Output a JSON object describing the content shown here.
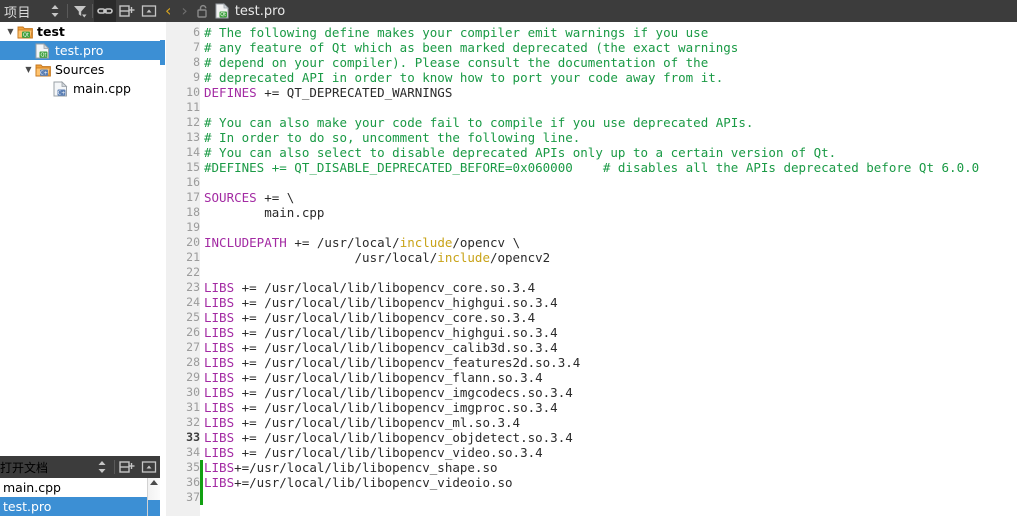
{
  "project_panel": {
    "title": "项目",
    "toolbar": [
      {
        "name": "sync-sort-icon",
        "glyph": "sort"
      },
      {
        "name": "filter-icon",
        "glyph": "filter"
      },
      {
        "name": "link-with-editor-icon",
        "glyph": "link",
        "active": true
      },
      {
        "name": "split-add-icon",
        "glyph": "split-add"
      },
      {
        "name": "close-panel-icon",
        "glyph": "close-panel"
      }
    ],
    "tree": [
      {
        "label": "test",
        "icon": "qt-folder-icon",
        "depth": 0,
        "twist": "down",
        "bold": true,
        "selected": false
      },
      {
        "label": "test.pro",
        "icon": "qt-pro-file-icon",
        "depth": 1,
        "twist": "",
        "bold": false,
        "selected": true
      },
      {
        "label": "Sources",
        "icon": "cpp-folder-icon",
        "depth": 1,
        "twist": "down",
        "bold": false,
        "selected": false
      },
      {
        "label": "main.cpp",
        "icon": "cpp-file-icon",
        "depth": 2,
        "twist": "",
        "bold": false,
        "selected": false
      }
    ]
  },
  "open_documents": {
    "title": "打开文档",
    "toolbar": [
      {
        "name": "sync-sort-icon",
        "glyph": "sort"
      },
      {
        "name": "split-add-icon",
        "glyph": "split-add"
      },
      {
        "name": "close-panel-icon",
        "glyph": "close-panel"
      }
    ],
    "items": [
      {
        "label": "main.cpp",
        "selected": false
      },
      {
        "label": "test.pro",
        "selected": true
      }
    ]
  },
  "editor_toolbar": {
    "back_glyph": "‹",
    "forward_glyph": "›",
    "lock_icon": "unlocked-padlock-icon",
    "file_icon": "qt-pro-file-icon",
    "tab_label": "test.pro"
  },
  "editor": {
    "first_line_number": 6,
    "current_line_number": 33,
    "marker": {
      "top_line": 7,
      "lines": 1
    },
    "changed_lines": [
      35,
      36,
      37
    ],
    "lines": [
      {
        "n": 6,
        "tokens": [
          {
            "t": "# The following define makes your compiler emit warnings if you use",
            "c": "cmt"
          }
        ]
      },
      {
        "n": 7,
        "tokens": [
          {
            "t": "# any feature of Qt which as been marked deprecated (the exact warnings",
            "c": "cmt"
          }
        ]
      },
      {
        "n": 8,
        "tokens": [
          {
            "t": "# depend on your compiler). Please consult the documentation of the",
            "c": "cmt"
          }
        ]
      },
      {
        "n": 9,
        "tokens": [
          {
            "t": "# deprecated API in order to know how to port your code away from it.",
            "c": "cmt"
          }
        ]
      },
      {
        "n": 10,
        "tokens": [
          {
            "t": "DEFINES",
            "c": "kw"
          },
          {
            "t": " += QT_DEPRECATED_WARNINGS",
            "c": "op"
          }
        ]
      },
      {
        "n": 11,
        "tokens": []
      },
      {
        "n": 12,
        "tokens": [
          {
            "t": "# You can also make your code fail to compile if you use deprecated APIs.",
            "c": "cmt"
          }
        ]
      },
      {
        "n": 13,
        "tokens": [
          {
            "t": "# In order to do so, uncomment the following line.",
            "c": "cmt"
          }
        ]
      },
      {
        "n": 14,
        "tokens": [
          {
            "t": "# You can also select to disable deprecated APIs only up to a certain version of Qt.",
            "c": "cmt"
          }
        ]
      },
      {
        "n": 15,
        "tokens": [
          {
            "t": "#DEFINES += QT_DISABLE_DEPRECATED_BEFORE=0x060000    # disables all the APIs deprecated before Qt 6.0.0",
            "c": "cmt"
          }
        ]
      },
      {
        "n": 16,
        "tokens": []
      },
      {
        "n": 17,
        "tokens": [
          {
            "t": "SOURCES",
            "c": "kw"
          },
          {
            "t": " += \\",
            "c": "op"
          }
        ]
      },
      {
        "n": 18,
        "tokens": [
          {
            "t": "        main.cpp",
            "c": "op"
          }
        ]
      },
      {
        "n": 19,
        "tokens": []
      },
      {
        "n": 20,
        "tokens": [
          {
            "t": "INCLUDEPATH",
            "c": "kw"
          },
          {
            "t": " += /usr/local/",
            "c": "op"
          },
          {
            "t": "include",
            "c": "fn"
          },
          {
            "t": "/opencv \\",
            "c": "op"
          }
        ]
      },
      {
        "n": 21,
        "tokens": [
          {
            "t": "                    /usr/local/",
            "c": "op"
          },
          {
            "t": "include",
            "c": "fn"
          },
          {
            "t": "/opencv2",
            "c": "op"
          }
        ]
      },
      {
        "n": 22,
        "tokens": []
      },
      {
        "n": 23,
        "tokens": [
          {
            "t": "LIBS",
            "c": "kw"
          },
          {
            "t": " += /usr/local/lib/libopencv_core.so.3.4",
            "c": "op"
          }
        ]
      },
      {
        "n": 24,
        "tokens": [
          {
            "t": "LIBS",
            "c": "kw"
          },
          {
            "t": " += /usr/local/lib/libopencv_highgui.so.3.4",
            "c": "op"
          }
        ]
      },
      {
        "n": 25,
        "tokens": [
          {
            "t": "LIBS",
            "c": "kw"
          },
          {
            "t": " += /usr/local/lib/libopencv_core.so.3.4",
            "c": "op"
          }
        ]
      },
      {
        "n": 26,
        "tokens": [
          {
            "t": "LIBS",
            "c": "kw"
          },
          {
            "t": " += /usr/local/lib/libopencv_highgui.so.3.4",
            "c": "op"
          }
        ]
      },
      {
        "n": 27,
        "tokens": [
          {
            "t": "LIBS",
            "c": "kw"
          },
          {
            "t": " += /usr/local/lib/libopencv_calib3d.so.3.4",
            "c": "op"
          }
        ]
      },
      {
        "n": 28,
        "tokens": [
          {
            "t": "LIBS",
            "c": "kw"
          },
          {
            "t": " += /usr/local/lib/libopencv_features2d.so.3.4",
            "c": "op"
          }
        ]
      },
      {
        "n": 29,
        "tokens": [
          {
            "t": "LIBS",
            "c": "kw"
          },
          {
            "t": " += /usr/local/lib/libopencv_flann.so.3.4",
            "c": "op"
          }
        ]
      },
      {
        "n": 30,
        "tokens": [
          {
            "t": "LIBS",
            "c": "kw"
          },
          {
            "t": " += /usr/local/lib/libopencv_imgcodecs.so.3.4",
            "c": "op"
          }
        ]
      },
      {
        "n": 31,
        "tokens": [
          {
            "t": "LIBS",
            "c": "kw"
          },
          {
            "t": " += /usr/local/lib/libopencv_imgproc.so.3.4",
            "c": "op"
          }
        ]
      },
      {
        "n": 32,
        "tokens": [
          {
            "t": "LIBS",
            "c": "kw"
          },
          {
            "t": " += /usr/local/lib/libopencv_ml.so.3.4",
            "c": "op"
          }
        ]
      },
      {
        "n": 33,
        "tokens": [
          {
            "t": "LIBS",
            "c": "kw"
          },
          {
            "t": " += /usr/local/lib/libopencv_objdetect.so.3.4",
            "c": "op"
          }
        ]
      },
      {
        "n": 34,
        "tokens": [
          {
            "t": "LIBS",
            "c": "kw"
          },
          {
            "t": " += /usr/local/lib/libopencv_video.so.3.4",
            "c": "op"
          }
        ]
      },
      {
        "n": 35,
        "tokens": [
          {
            "t": "LIBS",
            "c": "kw"
          },
          {
            "t": "+=/usr/local/lib/libopencv_shape.so",
            "c": "op"
          }
        ]
      },
      {
        "n": 36,
        "tokens": [
          {
            "t": "LIBS",
            "c": "kw"
          },
          {
            "t": "+=/usr/local/lib/libopencv_videoio.so",
            "c": "op"
          }
        ]
      },
      {
        "n": 37,
        "tokens": []
      }
    ]
  },
  "colors": {
    "toolbar_bg": "#3c3c3c",
    "selection_blue": "#3c8fd4",
    "comment_green": "#1a9a45",
    "keyword_purple": "#a32ba3",
    "function_yellow": "#c8a318",
    "change_marker_green": "#12a012",
    "gutter_bg": "#f0f0f0"
  }
}
